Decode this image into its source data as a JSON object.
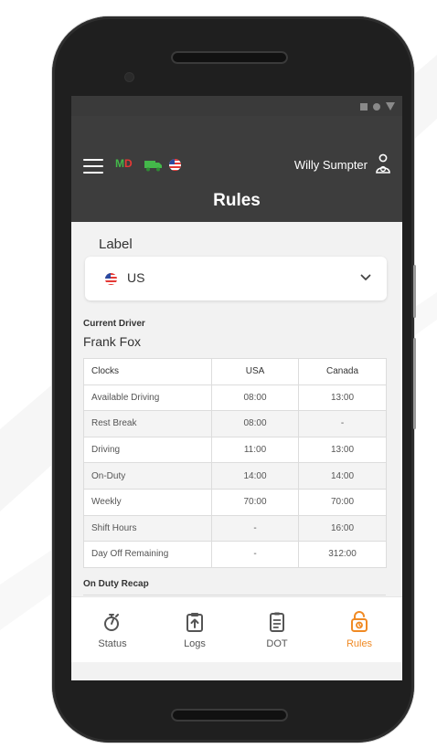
{
  "status_bar": {
    "icons": [
      "square-icon",
      "circle-icon",
      "triangle-icon"
    ]
  },
  "header": {
    "status_code_green": "M",
    "status_code_red": "D",
    "user_name": "Willy Sumpter",
    "title": "Rules"
  },
  "label_section": {
    "label": "Label",
    "selected_value": "US"
  },
  "driver": {
    "caption": "Current Driver",
    "name": "Frank Fox"
  },
  "clocks_table": {
    "headers": [
      "Clocks",
      "USA",
      "Canada"
    ],
    "rows": [
      [
        "Available Driving",
        "08:00",
        "13:00"
      ],
      [
        "Rest Break",
        "08:00",
        "-"
      ],
      [
        "Driving",
        "11:00",
        "13:00"
      ],
      [
        "On-Duty",
        "14:00",
        "14:00"
      ],
      [
        "Weekly",
        "70:00",
        "70:00"
      ],
      [
        "Shift Hours",
        "-",
        "16:00"
      ],
      [
        "Day Off Remaining",
        "-",
        "312:00"
      ]
    ]
  },
  "recap": {
    "caption": "On Duty Recap"
  },
  "bottom_nav": {
    "items": [
      {
        "label": "Status",
        "icon": "stopwatch-icon"
      },
      {
        "label": "Logs",
        "icon": "clipboard-upload-icon"
      },
      {
        "label": "DOT",
        "icon": "document-icon"
      },
      {
        "label": "Rules",
        "icon": "rules-lock-icon"
      }
    ],
    "active": "Rules"
  },
  "colors": {
    "header_bg": "#3d3d3d",
    "accent": "#f08a24",
    "status_green": "#44b84a",
    "status_red": "#e53935"
  }
}
